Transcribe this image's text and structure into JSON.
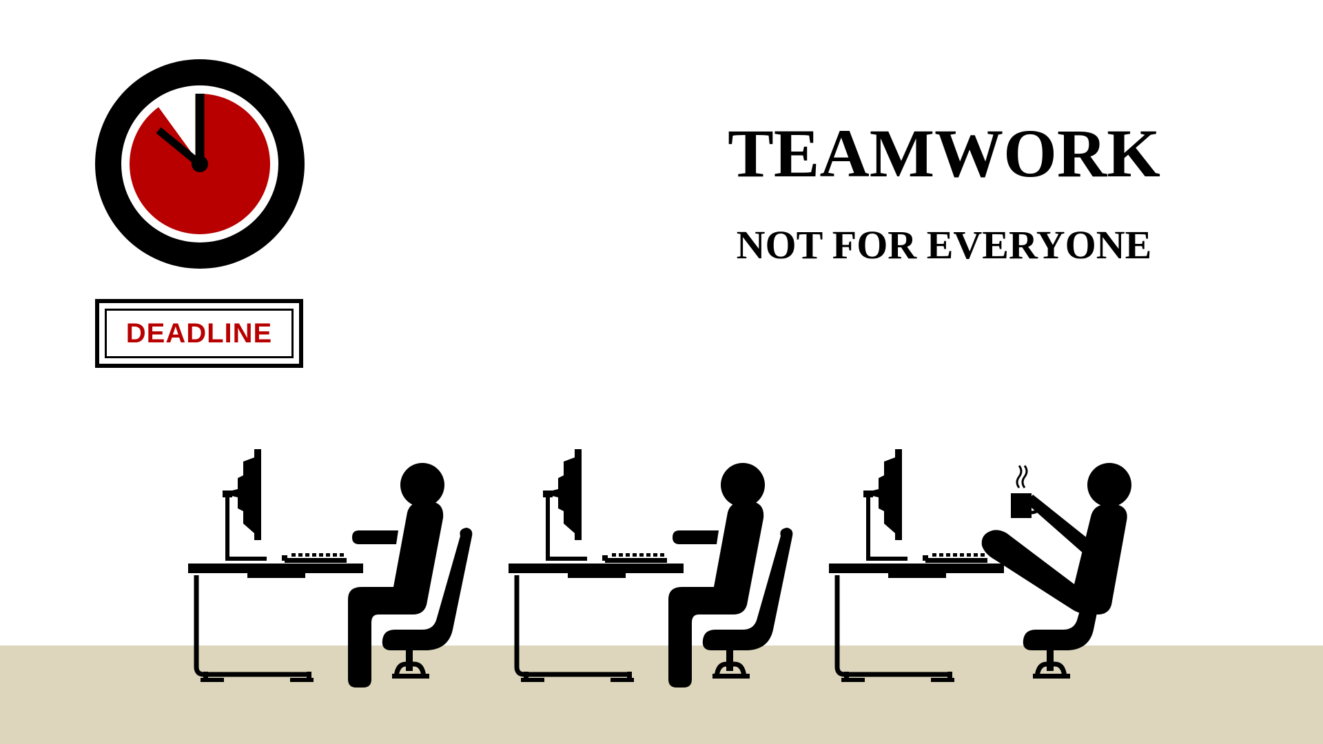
{
  "title": "TEAMWORK",
  "subtitle": "NOT FOR EVERYONE",
  "sign": {
    "label": "DEADLINE"
  },
  "clock": {
    "remaining_fraction": 0.9
  },
  "workers": [
    {
      "pose": "typing"
    },
    {
      "pose": "typing"
    },
    {
      "pose": "relaxing-with-coffee"
    }
  ],
  "icons": [
    "clock-icon",
    "computer-monitor-icon",
    "keyboard-icon",
    "office-chair-icon",
    "person-icon",
    "coffee-mug-icon",
    "steam-icon"
  ],
  "colors": {
    "background": "#ffffff",
    "floor": "#ddd6bc",
    "accent_red": "#b80000",
    "ink": "#000000"
  }
}
